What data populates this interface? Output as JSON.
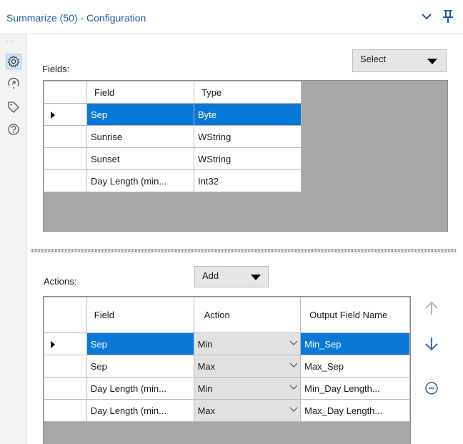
{
  "window": {
    "title": "Summarize (50) - Configuration"
  },
  "sidebar": {
    "dots": "...",
    "icons": [
      "gear-icon",
      "navigate-icon",
      "tag-icon",
      "help-icon"
    ]
  },
  "fields": {
    "label": "Fields:",
    "select_label": "Select",
    "columns": [
      "Field",
      "Type"
    ],
    "rows": [
      {
        "field": "Sep",
        "type": "Byte"
      },
      {
        "field": "Sunrise",
        "type": "WString"
      },
      {
        "field": "Sunset",
        "type": "WString"
      },
      {
        "field": "Day Length (min...",
        "type": "Int32"
      }
    ]
  },
  "actions": {
    "label": "Actions:",
    "add_label": "Add",
    "columns": [
      "Field",
      "Action",
      "Output Field Name"
    ],
    "rows": [
      {
        "field": "Sep",
        "action": "Min",
        "output": "Min_Sep"
      },
      {
        "field": "Sep",
        "action": "Max",
        "output": "Max_Sep"
      },
      {
        "field": "Day Length (min...",
        "action": "Min",
        "output": "Min_Day Length..."
      },
      {
        "field": "Day Length (min...",
        "action": "Max",
        "output": "Max_Day Length..."
      }
    ]
  },
  "colors": {
    "selection": "#0a78d7",
    "accent": "#1e5aa8",
    "grid_bg": "#a8a8a8"
  }
}
